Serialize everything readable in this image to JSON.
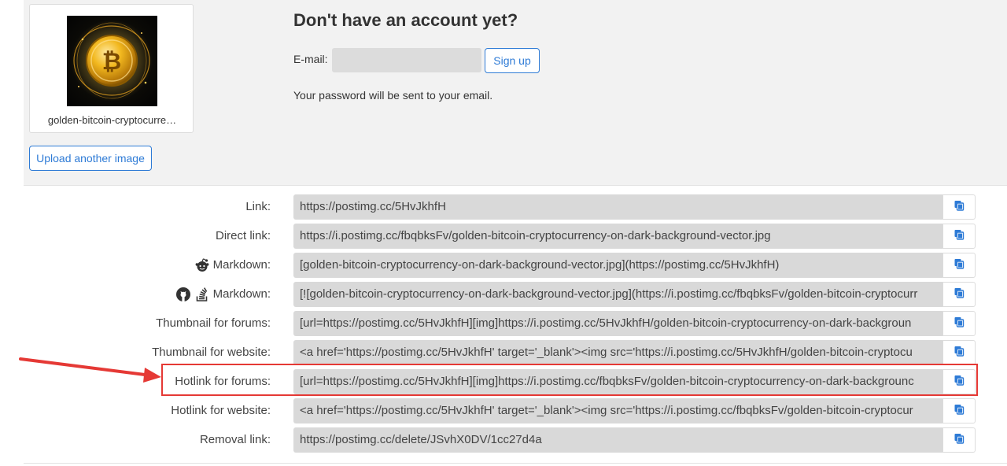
{
  "image_card": {
    "filename": "golden-bitcoin-cryptocurre…",
    "upload_another_label": "Upload another image"
  },
  "signup": {
    "title": "Don't have an account yet?",
    "email_label": "E-mail:",
    "email_value": "",
    "email_placeholder": "",
    "signup_label": "Sign up",
    "password_note": "Your password will be sent to your email."
  },
  "links": [
    {
      "label": "Link:",
      "icons": [],
      "value": "https://postimg.cc/5HvJkhfH"
    },
    {
      "label": "Direct link:",
      "icons": [],
      "value": "https://i.postimg.cc/fbqbksFv/golden-bitcoin-cryptocurrency-on-dark-background-vector.jpg"
    },
    {
      "label": "Markdown:",
      "icons": [
        "reddit-icon"
      ],
      "value": "[golden-bitcoin-cryptocurrency-on-dark-background-vector.jpg](https://postimg.cc/5HvJkhfH)"
    },
    {
      "label": "Markdown:",
      "icons": [
        "github-icon",
        "stackoverflow-icon"
      ],
      "value": "[![golden-bitcoin-cryptocurrency-on-dark-background-vector.jpg](https://i.postimg.cc/fbqbksFv/golden-bitcoin-cryptocurr"
    },
    {
      "label": "Thumbnail for forums:",
      "icons": [],
      "value": "[url=https://postimg.cc/5HvJkhfH][img]https://i.postimg.cc/5HvJkhfH/golden-bitcoin-cryptocurrency-on-dark-backgroun"
    },
    {
      "label": "Thumbnail for website:",
      "icons": [],
      "value": "<a href='https://postimg.cc/5HvJkhfH' target='_blank'><img src='https://i.postimg.cc/5HvJkhfH/golden-bitcoin-cryptocu"
    },
    {
      "label": "Hotlink for forums:",
      "icons": [],
      "value": "[url=https://postimg.cc/5HvJkhfH][img]https://i.postimg.cc/fbqbksFv/golden-bitcoin-cryptocurrency-on-dark-backgrounc"
    },
    {
      "label": "Hotlink for website:",
      "icons": [],
      "value": "<a href='https://postimg.cc/5HvJkhfH' target='_blank'><img src='https://i.postimg.cc/fbqbksFv/golden-bitcoin-cryptocur"
    },
    {
      "label": "Removal link:",
      "icons": [],
      "value": "https://postimg.cc/delete/JSvhX0DV/1cc27d4a"
    }
  ],
  "annotation": {
    "highlighted_row": "Hotlink for forums:",
    "color": "#e53935"
  },
  "colors": {
    "accent": "#2e7bd6",
    "field_bg": "#d9d9d9",
    "panel_bg": "#f2f2f2"
  }
}
